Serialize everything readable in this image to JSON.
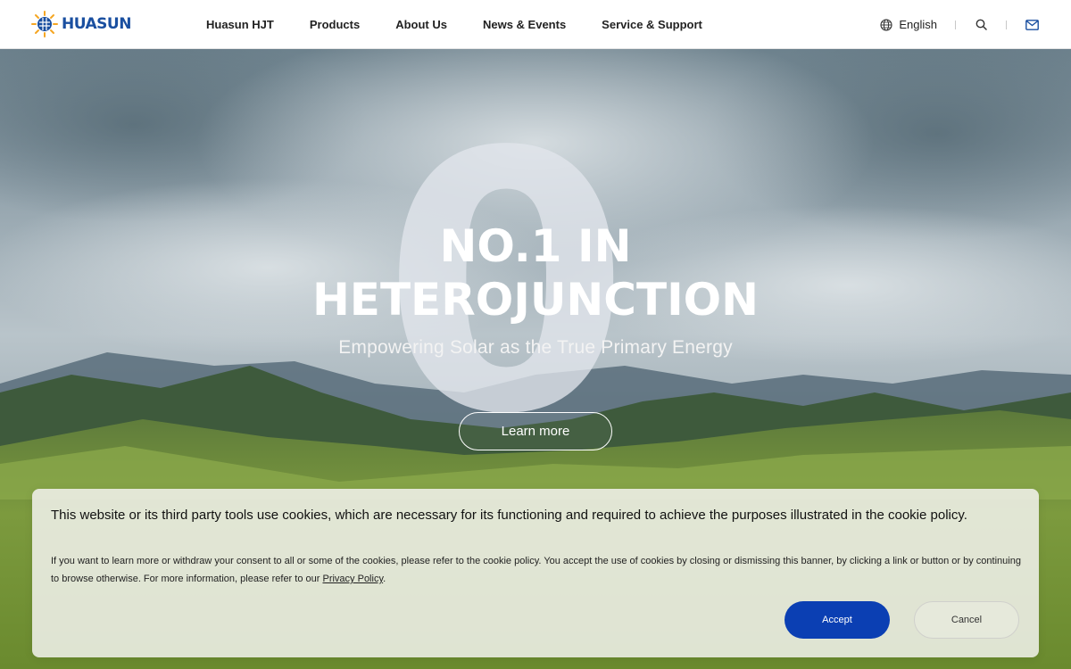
{
  "brand": {
    "name": "HUASUN",
    "colors": {
      "primary": "#1a4fa0",
      "accent": "#f5a623",
      "button": "#0b3fb3"
    }
  },
  "header": {
    "nav": [
      {
        "label": "Huasun HJT"
      },
      {
        "label": "Products"
      },
      {
        "label": "About Us"
      },
      {
        "label": "News & Events"
      },
      {
        "label": "Service & Support"
      }
    ],
    "language": {
      "label": "English",
      "icon": "globe-icon"
    },
    "search_icon": "search-icon",
    "mail_icon": "mail-icon"
  },
  "hero": {
    "big_char": "0",
    "title_line1": "NO.1 IN",
    "title_line2": "HETEROJUNCTION",
    "subtitle": "Empowering Solar as the True Primary Energy",
    "cta": "Learn more"
  },
  "cookie_banner": {
    "main_text": "This website or its third party tools use cookies, which are necessary for its functioning and required to achieve the purposes illustrated in the cookie policy.",
    "detail_text": "If you want to learn more or withdraw your consent to all or some of the cookies, please refer to the cookie policy. You accept the use of cookies by closing or dismissing this banner, by clicking a link or button or by continuing to browse otherwise. For more information, please refer to our",
    "privacy_link": "Privacy Policy",
    "trailing_punct": ".",
    "accept": "Accept",
    "cancel": "Cancel"
  }
}
